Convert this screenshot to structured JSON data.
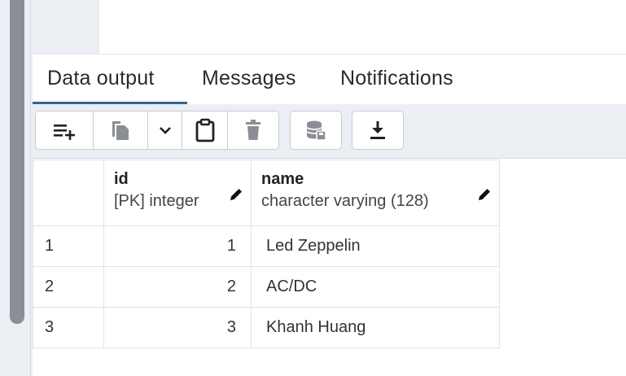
{
  "tabs": [
    {
      "label": "Data output",
      "active": true
    },
    {
      "label": "Messages",
      "active": false
    },
    {
      "label": "Notifications",
      "active": false
    }
  ],
  "toolbar": {
    "icons": [
      "add-row-icon",
      "copy-icon",
      "chevron-down-icon",
      "paste-icon",
      "delete-icon",
      "save-data-icon",
      "download-icon"
    ]
  },
  "grid": {
    "columns": [
      {
        "name": "id",
        "type": "[PK] integer"
      },
      {
        "name": "name",
        "type": "character varying (128)"
      }
    ],
    "rows": [
      {
        "rownum": "1",
        "id": "1",
        "name": "Led Zeppelin"
      },
      {
        "rownum": "2",
        "id": "2",
        "name": "AC/DC"
      },
      {
        "rownum": "3",
        "id": "3",
        "name": "Khanh Huang"
      }
    ]
  },
  "colors": {
    "accent": "#326690",
    "toolbar_bg": "#ebeef3",
    "border": "#dfe2e7"
  }
}
